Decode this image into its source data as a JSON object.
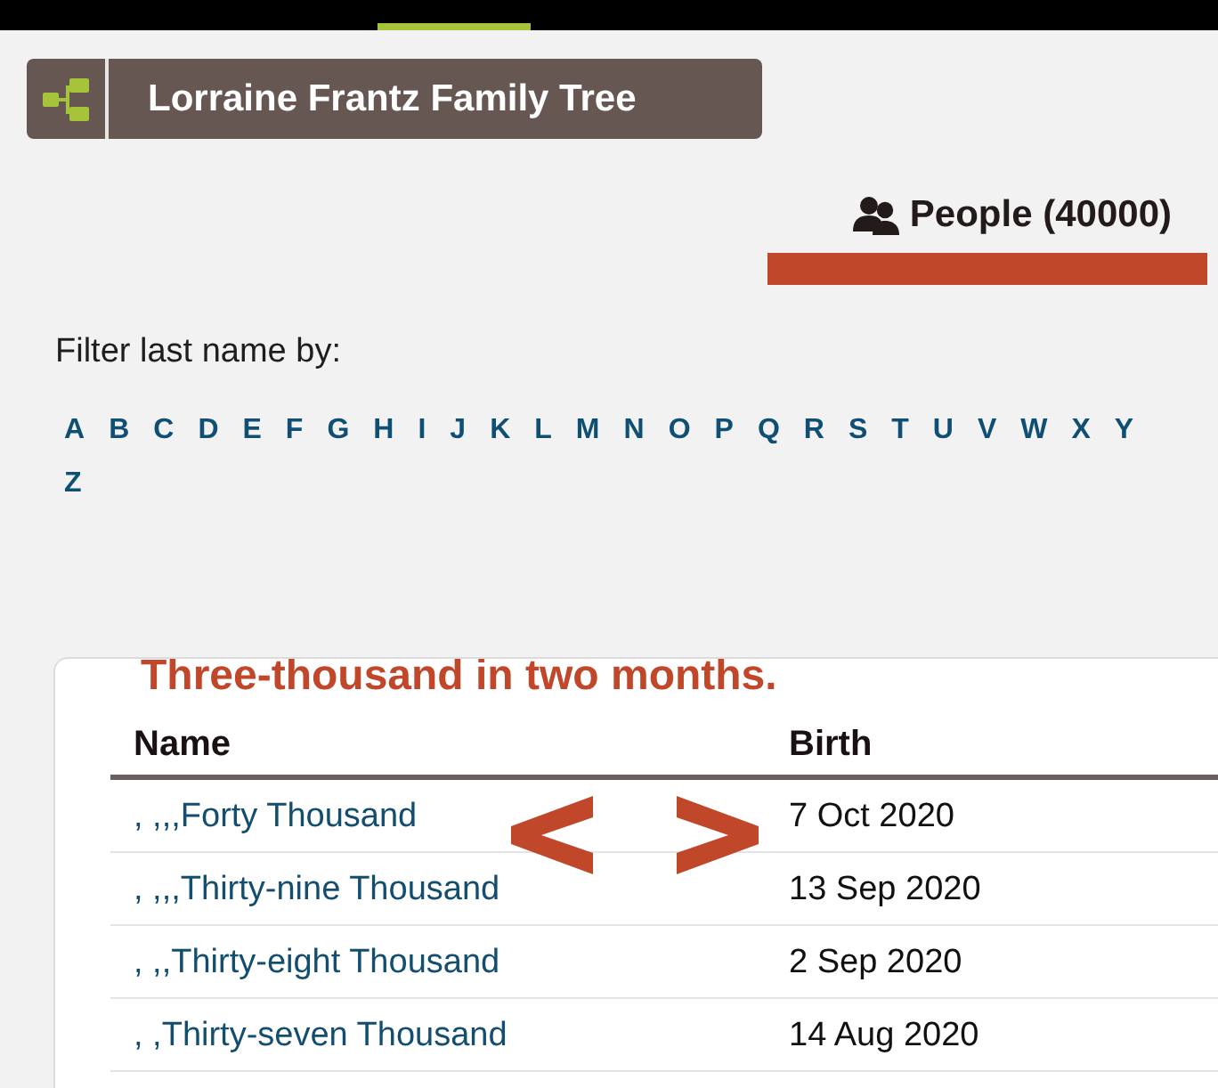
{
  "top_bar": {
    "highlight": true
  },
  "tree_header": {
    "title": "Lorraine Frantz Family Tree"
  },
  "people_tab": {
    "label": "People (40000)",
    "marked": true
  },
  "filter": {
    "label": "Filter last name by:",
    "letters": [
      "A",
      "B",
      "C",
      "D",
      "E",
      "F",
      "G",
      "H",
      "I",
      "J",
      "K",
      "L",
      "M",
      "N",
      "O",
      "P",
      "Q",
      "R",
      "S",
      "T",
      "U",
      "V",
      "W",
      "X",
      "Y",
      "Z"
    ]
  },
  "note": {
    "text": "Three-thousand in two months."
  },
  "table": {
    "columns": [
      "Name",
      "Birth"
    ],
    "rows": [
      {
        "name": ", ,,,Forty Thousand",
        "birth": "7 Oct 2020"
      },
      {
        "name": ", ,,,Thirty-nine Thousand",
        "birth": "13 Sep 2020"
      },
      {
        "name": ", ,,Thirty-eight Thousand",
        "birth": "2 Sep 2020"
      },
      {
        "name": ", ,Thirty-seven Thousand",
        "birth": "14 Aug 2020"
      }
    ]
  }
}
